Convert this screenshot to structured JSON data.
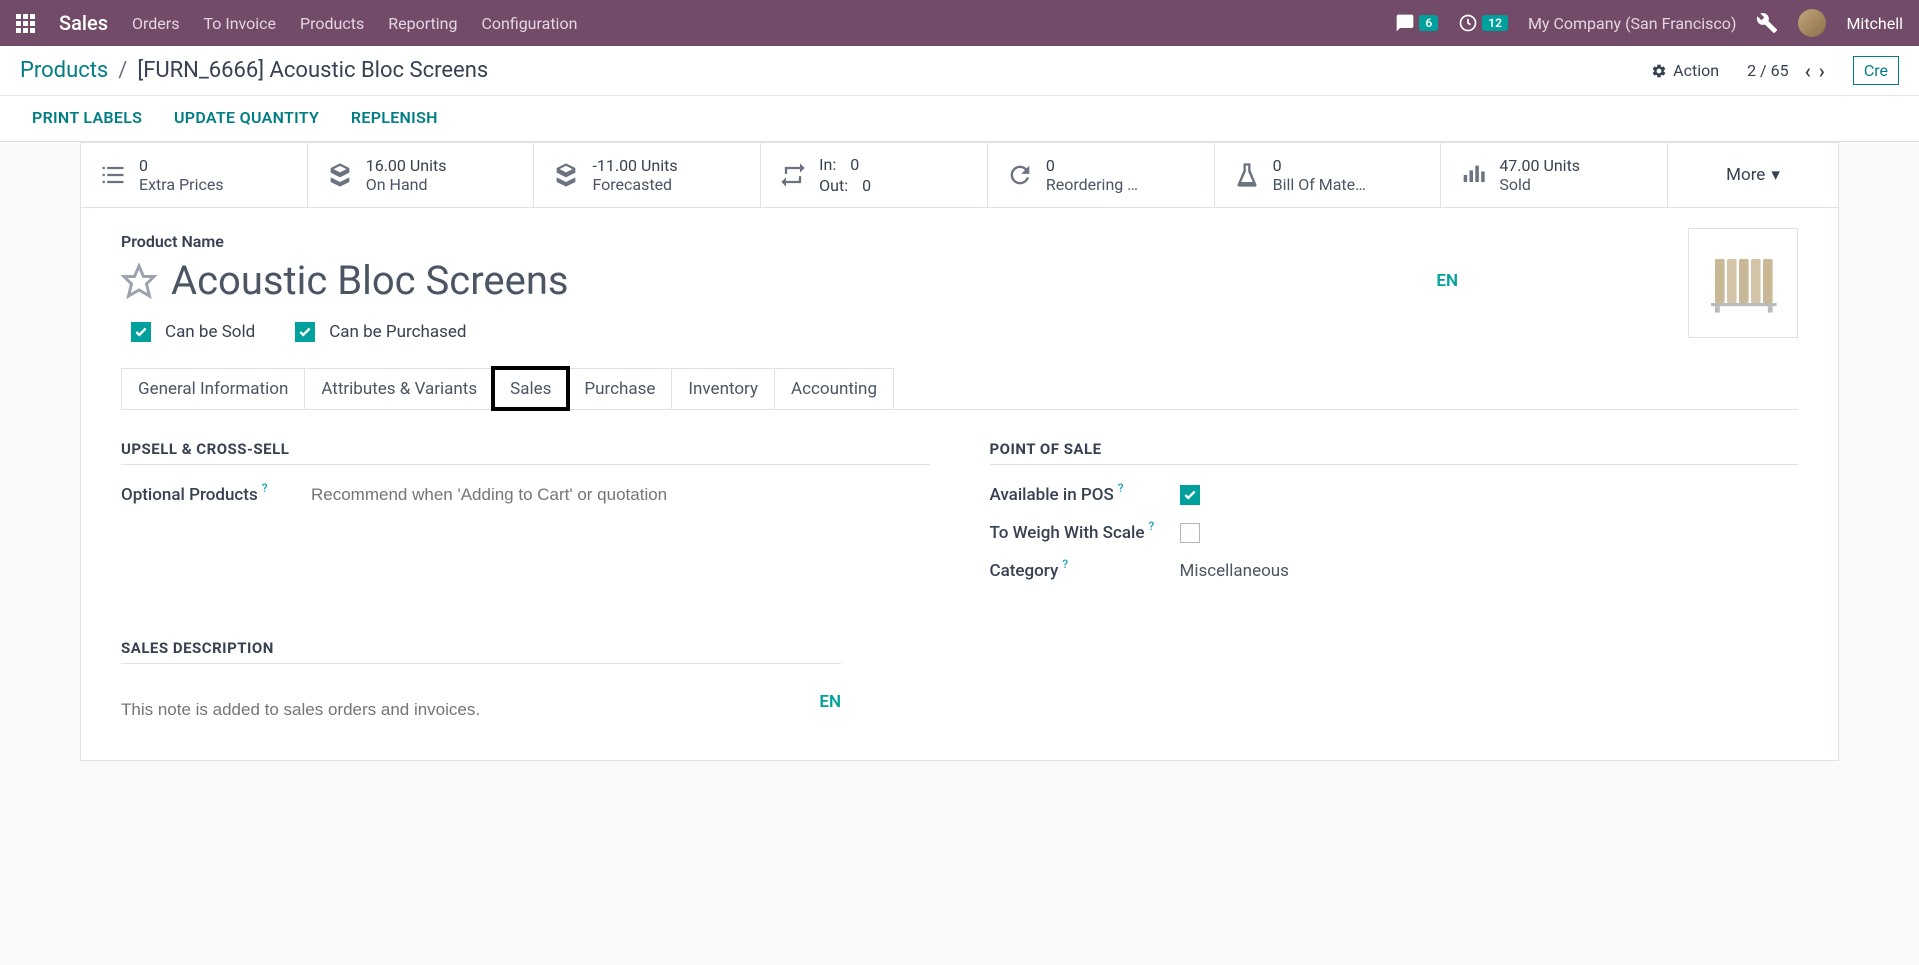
{
  "navbar": {
    "brand": "Sales",
    "links": [
      "Orders",
      "To Invoice",
      "Products",
      "Reporting",
      "Configuration"
    ],
    "messages_badge": "6",
    "activities_badge": "12",
    "company": "My Company (San Francisco)",
    "user": "Mitchell"
  },
  "breadcrumb": {
    "parent": "Products",
    "current": "[FURN_6666] Acoustic Bloc Screens",
    "action_label": "Action",
    "pager": "2 / 65",
    "create_label": "Cre"
  },
  "action_buttons": [
    "PRINT LABELS",
    "UPDATE QUANTITY",
    "REPLENISH"
  ],
  "stats": {
    "extra_prices": {
      "value": "0",
      "label": "Extra Prices"
    },
    "on_hand": {
      "value": "16.00 Units",
      "label": "On Hand"
    },
    "forecasted": {
      "value": "-11.00 Units",
      "label": "Forecasted"
    },
    "inout": {
      "in_label": "In:",
      "in_value": "0",
      "out_label": "Out:",
      "out_value": "0"
    },
    "reordering": {
      "value": "0",
      "label": "Reordering …"
    },
    "bom": {
      "value": "0",
      "label": "Bill Of Mate…"
    },
    "sold": {
      "value": "47.00 Units",
      "label": "Sold"
    },
    "more": "More"
  },
  "product": {
    "name_label": "Product Name",
    "name": "Acoustic Bloc Screens",
    "lang": "EN",
    "can_be_sold_label": "Can be Sold",
    "can_be_purchased_label": "Can be Purchased"
  },
  "tabs": [
    "General Information",
    "Attributes & Variants",
    "Sales",
    "Purchase",
    "Inventory",
    "Accounting"
  ],
  "sales_tab": {
    "upsell_title": "UPSELL & CROSS-SELL",
    "optional_products_label": "Optional Products",
    "optional_products_placeholder": "Recommend when 'Adding to Cart' or quotation",
    "pos_title": "POINT OF SALE",
    "available_pos_label": "Available in POS",
    "weigh_label": "To Weigh With Scale",
    "category_label": "Category",
    "category_value": "Miscellaneous",
    "desc_title": "SALES DESCRIPTION",
    "desc_placeholder": "This note is added to sales orders and invoices.",
    "desc_lang": "EN"
  }
}
